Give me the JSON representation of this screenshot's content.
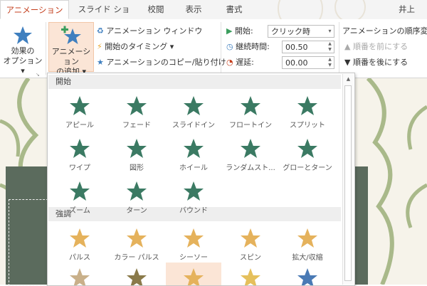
{
  "tabs": [
    {
      "label": "アニメーション",
      "active": true
    },
    {
      "label": "スライド ショー",
      "active": false
    },
    {
      "label": "校閲",
      "active": false
    },
    {
      "label": "表示",
      "active": false
    },
    {
      "label": "書式",
      "active": false
    }
  ],
  "user_name_partial": "井上",
  "ribbon": {
    "effect_options": {
      "line1": "効果の",
      "line2": "オプション ▾"
    },
    "add_animation": {
      "line1": "アニメーション",
      "line2": "の追加 ▾"
    },
    "animation_window": "アニメーション ウィンドウ",
    "timing_start": "開始のタイミング ▾",
    "animation_painter": "アニメーションのコピー/貼り付け",
    "start_label": "開始:",
    "start_value": "クリック時",
    "duration_label": "継続時間:",
    "duration_value": "00.50",
    "delay_label": "遅延:",
    "delay_value": "00.00",
    "reorder_title": "アニメーションの順序変更",
    "move_earlier": "順番を前にする",
    "move_later": "順番を後にする"
  },
  "gallery": {
    "sections": [
      {
        "title": "開始",
        "items": [
          "アピール",
          "フェード",
          "スライドイン",
          "フロートイン",
          "スプリット",
          "ワイプ",
          "図形",
          "ホイール",
          "ランダムスト...",
          "グローとターン",
          "ズーム",
          "ターン",
          "バウンド"
        ]
      },
      {
        "title": "強調",
        "items": [
          "パルス",
          "カラー パルス",
          "シーソー",
          "スピン",
          "拡大/収縮"
        ]
      }
    ]
  },
  "colors": {
    "entrance_star": "#3b7a63",
    "emphasis_star": "#e5b25c",
    "accent_tab": "#c43e1c",
    "highlight": "#fbe5d6"
  }
}
